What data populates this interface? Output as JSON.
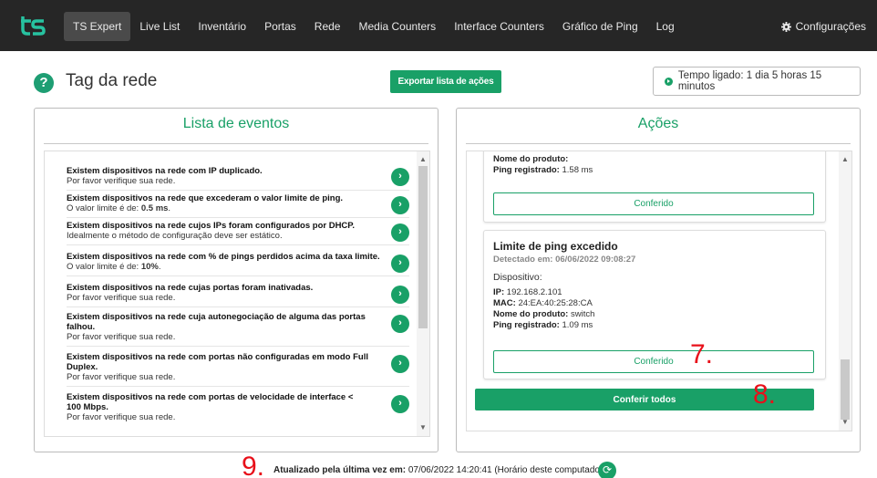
{
  "nav": {
    "items": [
      {
        "label": "TS Expert",
        "active": true
      },
      {
        "label": "Live List"
      },
      {
        "label": "Inventário"
      },
      {
        "label": "Portas"
      },
      {
        "label": "Rede"
      },
      {
        "label": "Media Counters"
      },
      {
        "label": "Interface Counters"
      },
      {
        "label": "Gráfico de Ping"
      },
      {
        "label": "Log"
      }
    ],
    "settings_label": "Configurações"
  },
  "header": {
    "title": "Tag da rede",
    "export_label": "Exportar lista de ações",
    "uptime": "Tempo ligado: 1 dia 5 horas 15 minutos"
  },
  "events_panel": {
    "title": "Lista de eventos",
    "items": [
      {
        "title": "Existem dispositivos na rede com IP duplicado.",
        "desc": "Por favor verifique sua rede."
      },
      {
        "title": "Existem dispositivos na rede que excederam o valor limite de ping.",
        "desc_prefix": "O valor limite é de: ",
        "desc_bold": "0.5 ms",
        "desc_suffix": "."
      },
      {
        "title": "Existem dispositivos na rede cujos IPs foram configurados por DHCP.",
        "desc": "Idealmente o método de configuração deve ser estático."
      },
      {
        "title": "Existem dispositivos na rede com % de pings perdidos acima da taxa limite.",
        "desc_prefix": "O valor limite é de: ",
        "desc_bold": "10%",
        "desc_suffix": "."
      },
      {
        "title": "Existem dispositivos na rede cujas portas foram inativadas.",
        "desc": "Por favor verifique sua rede."
      },
      {
        "title": "Existem dispositivos na rede cuja autonegociação de alguma das portas falhou.",
        "desc": "Por favor verifique sua rede."
      },
      {
        "title": "Existem dispositivos na rede com portas não configuradas em modo Full Duplex.",
        "desc": "Por favor verifique sua rede."
      },
      {
        "title": "Existem dispositivos na rede com portas de velocidade de interface < 100 Mbps.",
        "desc": "Por favor verifique sua rede."
      }
    ]
  },
  "actions_panel": {
    "title": "Ações",
    "card1": {
      "product_label": "Nome do produto:",
      "product_value": "",
      "ping_label": "Ping registrado:",
      "ping_value": " 1.58 ms",
      "button": "Conferido"
    },
    "card2": {
      "title": "Limite de ping excedido",
      "detected": "Detectado em: 06/06/2022 09:08:27",
      "device_label": "Dispositivo:",
      "ip_label": "IP:",
      "ip_value": " 192.168.2.101",
      "mac_label": "MAC:",
      "mac_value": " 24:EA:40:25:28:CA",
      "product_label": "Nome do produto:",
      "product_value": " switch",
      "ping_label": "Ping registrado:",
      "ping_value": " 1.09 ms",
      "button": "Conferido"
    },
    "check_all": "Conferir todos"
  },
  "annotations": {
    "a7": "7.",
    "a8": "8.",
    "a9": "9."
  },
  "footer": {
    "label": "Atualizado pela última vez em:",
    "value": " 07/06/2022 14:20:41 (Horário deste computador)"
  },
  "colors": {
    "accent": "#19a067",
    "navbar": "#262626",
    "annotation": "#e8101a"
  },
  "icons": {
    "logo": "ts-logo-icon",
    "help": "question-icon",
    "settings": "gear-icon",
    "event": "chevron-right-icon",
    "refresh": "refresh-icon"
  }
}
